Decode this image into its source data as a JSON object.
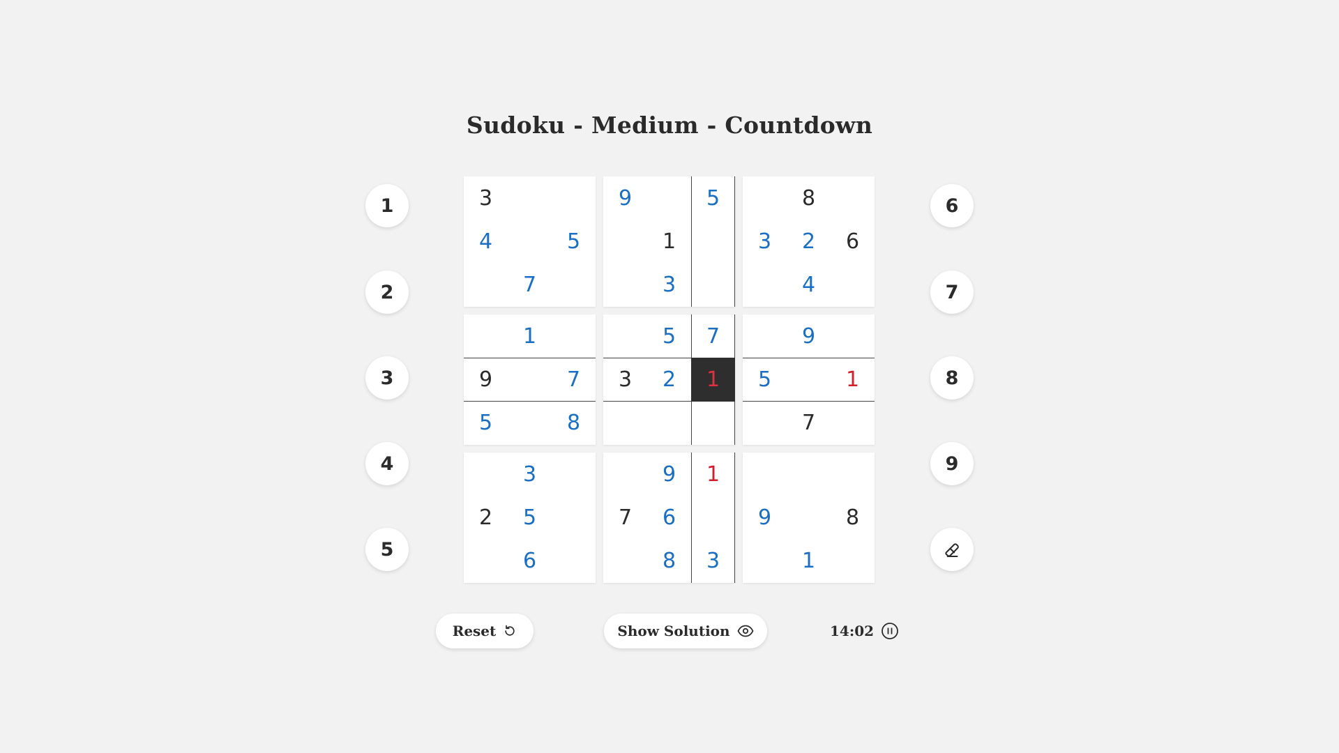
{
  "title": "Sudoku - Medium - Countdown",
  "grid": [
    [
      {
        "v": "3",
        "t": "given"
      },
      {
        "v": "",
        "t": ""
      },
      {
        "v": "",
        "t": ""
      },
      {
        "v": "9",
        "t": "user"
      },
      {
        "v": "",
        "t": ""
      },
      {
        "v": "5",
        "t": "user"
      },
      {
        "v": "",
        "t": ""
      },
      {
        "v": "8",
        "t": "given"
      },
      {
        "v": "",
        "t": ""
      }
    ],
    [
      {
        "v": "4",
        "t": "user"
      },
      {
        "v": "",
        "t": ""
      },
      {
        "v": "5",
        "t": "user"
      },
      {
        "v": "",
        "t": ""
      },
      {
        "v": "1",
        "t": "given"
      },
      {
        "v": "",
        "t": ""
      },
      {
        "v": "3",
        "t": "user"
      },
      {
        "v": "2",
        "t": "user"
      },
      {
        "v": "6",
        "t": "given"
      }
    ],
    [
      {
        "v": "",
        "t": ""
      },
      {
        "v": "7",
        "t": "user"
      },
      {
        "v": "",
        "t": ""
      },
      {
        "v": "",
        "t": ""
      },
      {
        "v": "3",
        "t": "user"
      },
      {
        "v": "",
        "t": ""
      },
      {
        "v": "",
        "t": ""
      },
      {
        "v": "4",
        "t": "user"
      },
      {
        "v": "",
        "t": ""
      }
    ],
    [
      {
        "v": "",
        "t": ""
      },
      {
        "v": "1",
        "t": "user"
      },
      {
        "v": "",
        "t": ""
      },
      {
        "v": "",
        "t": ""
      },
      {
        "v": "5",
        "t": "user"
      },
      {
        "v": "7",
        "t": "user"
      },
      {
        "v": "",
        "t": ""
      },
      {
        "v": "9",
        "t": "user"
      },
      {
        "v": "",
        "t": ""
      }
    ],
    [
      {
        "v": "9",
        "t": "given"
      },
      {
        "v": "",
        "t": ""
      },
      {
        "v": "7",
        "t": "user"
      },
      {
        "v": "3",
        "t": "given"
      },
      {
        "v": "2",
        "t": "user"
      },
      {
        "v": "1",
        "t": "selected"
      },
      {
        "v": "5",
        "t": "user"
      },
      {
        "v": "",
        "t": ""
      },
      {
        "v": "1",
        "t": "conflict"
      }
    ],
    [
      {
        "v": "5",
        "t": "user"
      },
      {
        "v": "",
        "t": ""
      },
      {
        "v": "8",
        "t": "user"
      },
      {
        "v": "",
        "t": ""
      },
      {
        "v": "",
        "t": ""
      },
      {
        "v": "",
        "t": ""
      },
      {
        "v": "",
        "t": ""
      },
      {
        "v": "7",
        "t": "given"
      },
      {
        "v": "",
        "t": ""
      }
    ],
    [
      {
        "v": "",
        "t": ""
      },
      {
        "v": "3",
        "t": "user"
      },
      {
        "v": "",
        "t": ""
      },
      {
        "v": "",
        "t": ""
      },
      {
        "v": "9",
        "t": "user"
      },
      {
        "v": "1",
        "t": "conflict"
      },
      {
        "v": "",
        "t": ""
      },
      {
        "v": "",
        "t": ""
      },
      {
        "v": "",
        "t": ""
      }
    ],
    [
      {
        "v": "2",
        "t": "given"
      },
      {
        "v": "5",
        "t": "user"
      },
      {
        "v": "",
        "t": ""
      },
      {
        "v": "7",
        "t": "given"
      },
      {
        "v": "6",
        "t": "user"
      },
      {
        "v": "",
        "t": ""
      },
      {
        "v": "9",
        "t": "user"
      },
      {
        "v": "",
        "t": ""
      },
      {
        "v": "8",
        "t": "given"
      }
    ],
    [
      {
        "v": "",
        "t": ""
      },
      {
        "v": "6",
        "t": "user"
      },
      {
        "v": "",
        "t": ""
      },
      {
        "v": "",
        "t": ""
      },
      {
        "v": "8",
        "t": "user"
      },
      {
        "v": "3",
        "t": "user"
      },
      {
        "v": "",
        "t": ""
      },
      {
        "v": "1",
        "t": "user"
      },
      {
        "v": ""
      }
    ]
  ],
  "selected_cell": {
    "row": 5,
    "col": 6
  },
  "digit_buttons_left": [
    "1",
    "2",
    "3",
    "4",
    "5"
  ],
  "digit_buttons_right": [
    "6",
    "7",
    "8",
    "9"
  ],
  "erase_button_icon": "eraser-icon",
  "controls": {
    "reset_label": "Reset",
    "reset_icon": "reset-icon",
    "show_solution_label": "Show Solution",
    "show_solution_icon": "eye-icon",
    "timer_value": "14:02",
    "pause_icon": "pause-icon"
  },
  "colors": {
    "given": "#2b2b2b",
    "user": "#1a6fc4",
    "conflict": "#d21f2e",
    "selected_bg": "#2e2e2e",
    "background": "#f2f2f2"
  }
}
